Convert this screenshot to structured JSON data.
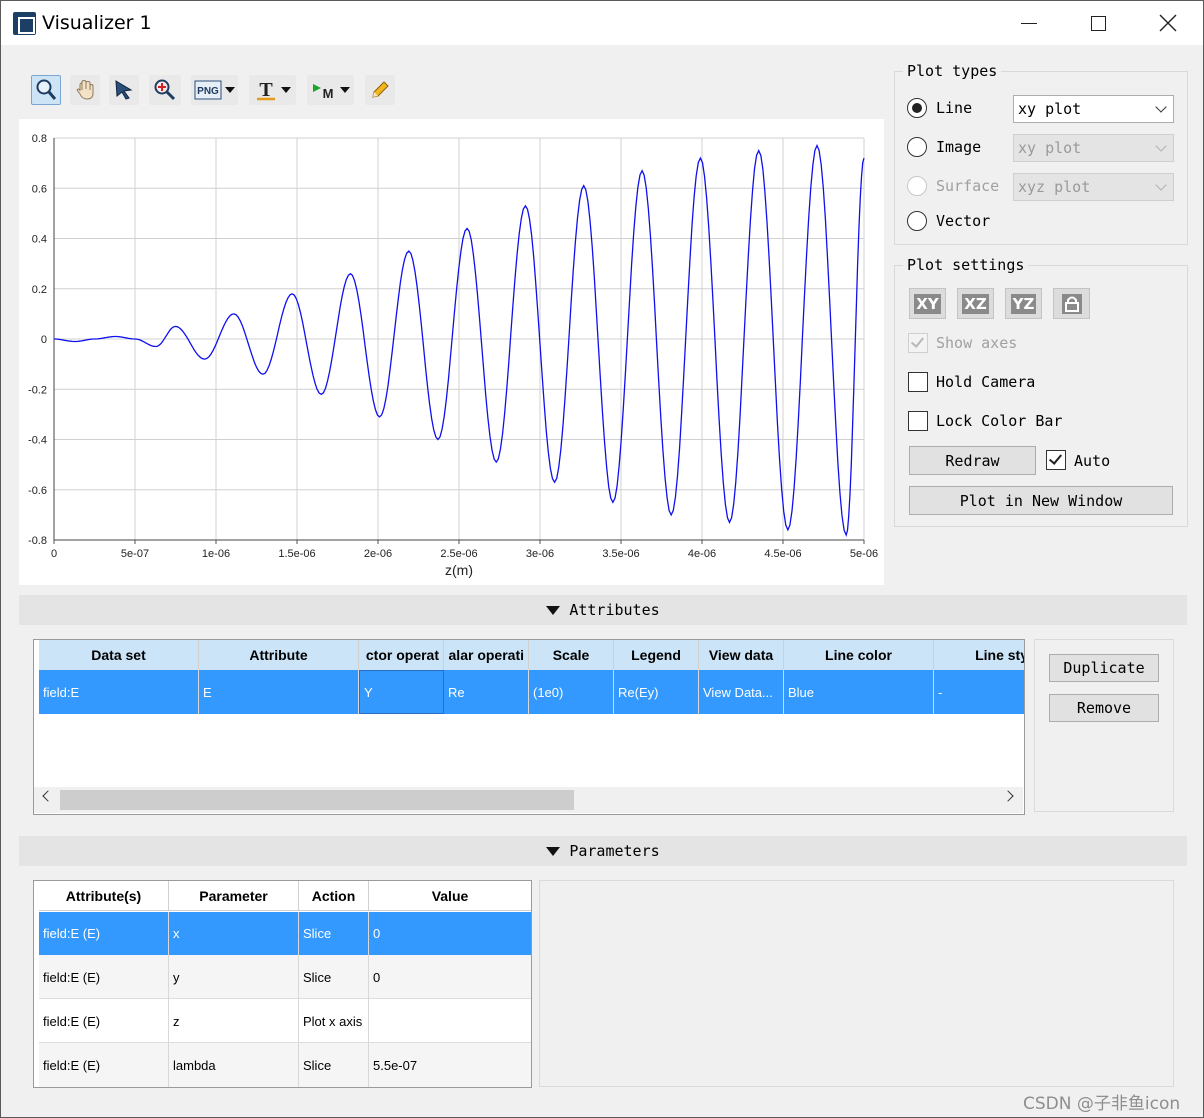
{
  "window": {
    "title": "Visualizer 1",
    "controls": [
      "minimize",
      "maximize",
      "close"
    ]
  },
  "toolbar": {
    "buttons": [
      {
        "name": "zoom",
        "icon": "magnifier-icon",
        "active": true
      },
      {
        "name": "pan",
        "icon": "hand-icon"
      },
      {
        "name": "select",
        "icon": "arrow-pointer-icon"
      },
      {
        "name": "zoom-region",
        "icon": "zoom-region-icon"
      },
      {
        "name": "export-png",
        "label": "PNG",
        "icon": "png-icon",
        "dropdown": true
      },
      {
        "name": "text",
        "label": "T",
        "icon": "text-tool-icon",
        "dropdown": true
      },
      {
        "name": "marker",
        "label": "M",
        "icon": "marker-icon",
        "dropdown": true
      },
      {
        "name": "edit",
        "icon": "pencil-icon"
      }
    ]
  },
  "chart_data": {
    "type": "line",
    "title": "",
    "xlabel": "z(m)",
    "ylabel": "",
    "xlim": [
      0,
      5e-06
    ],
    "ylim": [
      -0.8,
      0.8
    ],
    "x_tick_labels": [
      "0",
      "5e-07",
      "1e-06",
      "1.5e-06",
      "2e-06",
      "2.5e-06",
      "3e-06",
      "3.5e-06",
      "4e-06",
      "4.5e-06",
      "5e-06"
    ],
    "y_tick_labels": [
      "0.8",
      "0.6",
      "0.4",
      "0.2",
      "0",
      "-0.2",
      "-0.4",
      "-0.6",
      "-0.8"
    ],
    "grid": true,
    "series_color": "#1010ee",
    "series": [
      {
        "name": "",
        "x": [
          0,
          1.3e-07,
          2.5e-07,
          3.8e-07,
          5e-07,
          6.3e-07,
          7.5e-07,
          9.3e-07,
          1.11e-06,
          1.29e-06,
          1.47e-06,
          1.65e-06,
          1.83e-06,
          2.01e-06,
          2.19e-06,
          2.37e-06,
          2.55e-06,
          2.73e-06,
          2.91e-06,
          3.09e-06,
          3.27e-06,
          3.45e-06,
          3.63e-06,
          3.81e-06,
          3.99e-06,
          4.17e-06,
          4.35e-06,
          4.53e-06,
          4.71e-06,
          4.89e-06,
          5e-06
        ],
        "y": [
          0,
          -0.01,
          0,
          0.01,
          0,
          -0.03,
          0.05,
          -0.08,
          0.1,
          -0.14,
          0.18,
          -0.22,
          0.26,
          -0.31,
          0.35,
          -0.4,
          0.44,
          -0.49,
          0.53,
          -0.57,
          0.61,
          -0.65,
          0.67,
          -0.7,
          0.72,
          -0.73,
          0.75,
          -0.76,
          0.77,
          -0.78,
          0.72
        ]
      }
    ]
  },
  "plot_types": {
    "title": "Plot types",
    "options": [
      {
        "label": "Line",
        "checked": true,
        "disabled": false,
        "combo": "xy plot",
        "combo_disabled": false
      },
      {
        "label": "Image",
        "checked": false,
        "disabled": false,
        "combo": "xy plot",
        "combo_disabled": true
      },
      {
        "label": "Surface",
        "checked": false,
        "disabled": true,
        "combo": "xyz plot",
        "combo_disabled": true
      },
      {
        "label": "Vector",
        "checked": false,
        "disabled": false
      }
    ]
  },
  "plot_settings": {
    "title": "Plot settings",
    "planes": [
      "XY",
      "XZ",
      "YZ"
    ],
    "show_axes": {
      "label": "Show axes",
      "checked": true,
      "disabled": true
    },
    "hold_camera": {
      "label": "Hold Camera",
      "checked": false
    },
    "lock_color_bar": {
      "label": "Lock Color Bar",
      "checked": false
    },
    "redraw_label": "Redraw",
    "auto": {
      "label": "Auto",
      "checked": true
    },
    "plot_new_window_label": "Plot in New Window"
  },
  "attributes": {
    "section_label": "Attributes",
    "columns": [
      "Data set",
      "Attribute",
      "ctor operat",
      "alar operati",
      "Scale",
      "Legend",
      "View data",
      "Line color",
      "Line sty"
    ],
    "rows": [
      [
        "field:E",
        "E",
        "Y",
        "Re",
        "(1e0)",
        "Re(Ey)",
        "View Data...",
        "Blue",
        "-"
      ]
    ],
    "duplicate_label": "Duplicate",
    "remove_label": "Remove"
  },
  "parameters": {
    "section_label": "Parameters",
    "columns": [
      "Attribute(s)",
      "Parameter",
      "Action",
      "Value"
    ],
    "rows": [
      [
        "field:E (E)",
        "x",
        "Slice",
        "0"
      ],
      [
        "field:E (E)",
        "y",
        "Slice",
        "0"
      ],
      [
        "field:E (E)",
        "z",
        "Plot x axis",
        ""
      ],
      [
        "field:E (E)",
        "lambda",
        "Slice",
        "5.5e-07"
      ]
    ]
  },
  "watermark": "CSDN @子非鱼icon",
  "colors": {
    "selection": "#3399ff",
    "header": "#cce4f7",
    "line": "#1010ee"
  }
}
